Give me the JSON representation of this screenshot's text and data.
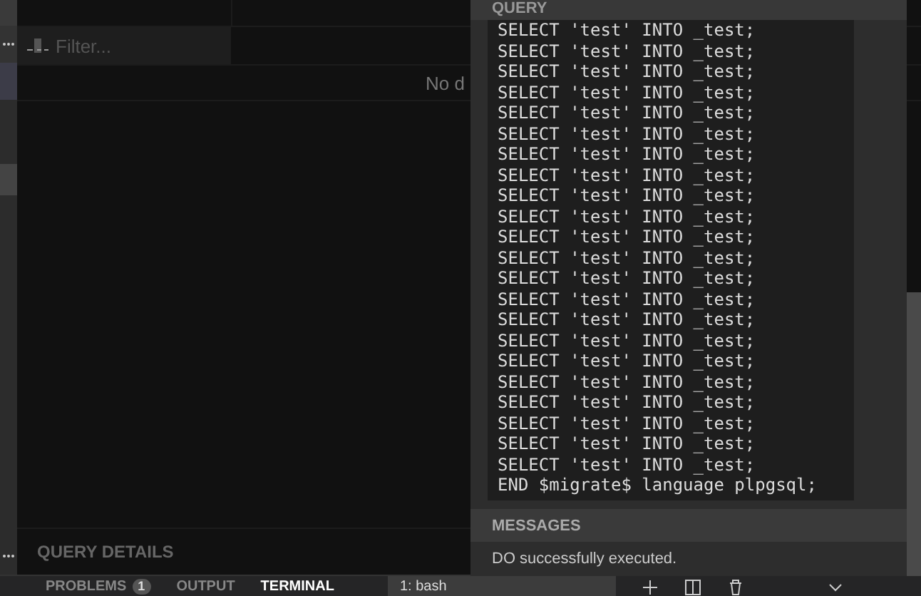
{
  "filter": {
    "placeholder": "Filter..."
  },
  "results": {
    "empty_text": "No d"
  },
  "query_details": {
    "title": "QUERY DETAILS"
  },
  "query_panel": {
    "title": "QUERY",
    "code_lines": [
      "SELECT 'test' INTO _test;",
      "SELECT 'test' INTO _test;",
      "SELECT 'test' INTO _test;",
      "SELECT 'test' INTO _test;",
      "SELECT 'test' INTO _test;",
      "SELECT 'test' INTO _test;",
      "SELECT 'test' INTO _test;",
      "SELECT 'test' INTO _test;",
      "SELECT 'test' INTO _test;",
      "SELECT 'test' INTO _test;",
      "SELECT 'test' INTO _test;",
      "SELECT 'test' INTO _test;",
      "SELECT 'test' INTO _test;",
      "SELECT 'test' INTO _test;",
      "SELECT 'test' INTO _test;",
      "SELECT 'test' INTO _test;",
      "SELECT 'test' INTO _test;",
      "SELECT 'test' INTO _test;",
      "SELECT 'test' INTO _test;",
      "SELECT 'test' INTO _test;",
      "SELECT 'test' INTO _test;",
      "SELECT 'test' INTO _test;",
      "END $migrate$ language plpgsql;"
    ],
    "messages_title": "MESSAGES",
    "messages": [
      "DO successfully executed."
    ]
  },
  "panel_tabs": [
    {
      "label": "PROBLEMS",
      "badge": "1",
      "selected": false
    },
    {
      "label": "OUTPUT",
      "selected": false
    },
    {
      "label": "TERMINAL",
      "selected": true
    }
  ],
  "terminal_select": {
    "value": "1: bash"
  }
}
